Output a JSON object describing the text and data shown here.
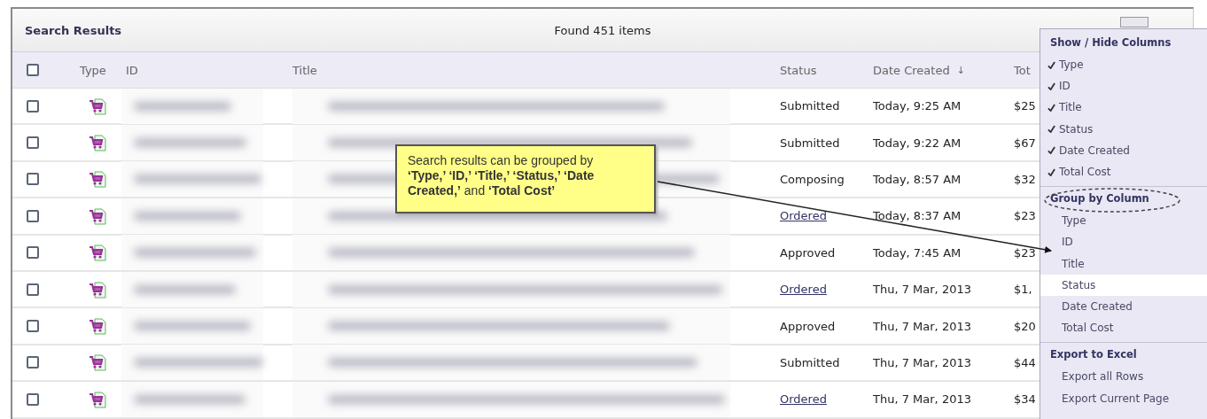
{
  "panel": {
    "title": "Search Results",
    "count": "Found 451 items"
  },
  "table": {
    "select_all": {
      "checked": false
    },
    "columns": [
      {
        "label": "Type"
      },
      {
        "label": "ID"
      },
      {
        "label": "Title"
      },
      {
        "label": "Status"
      },
      {
        "label": "Date Created",
        "sort_indicator": "↓"
      },
      {
        "label": "Tot"
      }
    ],
    "rows": [
      {
        "checked": false,
        "status": "Submitted",
        "linked": false,
        "date_created": "Today, 9:25 AM",
        "total_cost": "$25"
      },
      {
        "checked": false,
        "status": "Submitted",
        "linked": false,
        "date_created": "Today, 9:22 AM",
        "total_cost": "$67"
      },
      {
        "checked": false,
        "status": "Composing",
        "linked": false,
        "date_created": "Today, 8:57 AM",
        "total_cost": "$32"
      },
      {
        "checked": false,
        "status": "Ordered",
        "linked": true,
        "date_created": "Today, 8:37 AM",
        "total_cost": "$23"
      },
      {
        "checked": false,
        "status": "Approved",
        "linked": false,
        "date_created": "Today, 7:45 AM",
        "total_cost": "$23"
      },
      {
        "checked": false,
        "status": "Ordered",
        "linked": true,
        "date_created": "Thu, 7 Mar, 2013",
        "total_cost": "$1,"
      },
      {
        "checked": false,
        "status": "Approved",
        "linked": false,
        "date_created": "Thu, 7 Mar, 2013",
        "total_cost": "$20"
      },
      {
        "checked": false,
        "status": "Submitted",
        "linked": false,
        "date_created": "Thu, 7 Mar, 2013",
        "total_cost": "$44"
      },
      {
        "checked": false,
        "status": "Ordered",
        "linked": true,
        "date_created": "Thu, 7 Mar, 2013",
        "total_cost": "$34"
      }
    ]
  },
  "column_menu": {
    "sections": [
      {
        "heading": "Show / Hide Columns",
        "circled": false,
        "items": [
          {
            "label": "Type",
            "checked": true
          },
          {
            "label": "ID",
            "checked": true
          },
          {
            "label": "Title",
            "checked": true
          },
          {
            "label": "Status",
            "checked": true
          },
          {
            "label": "Date Created",
            "checked": true
          },
          {
            "label": "Total Cost",
            "checked": true
          }
        ]
      },
      {
        "heading": "Group by Column",
        "circled": true,
        "items": [
          {
            "label": "Type",
            "highlighted": false
          },
          {
            "label": "ID",
            "highlighted": false
          },
          {
            "label": "Title",
            "highlighted": false
          },
          {
            "label": "Status",
            "highlighted": true
          },
          {
            "label": "Date Created",
            "highlighted": false
          },
          {
            "label": "Total Cost",
            "highlighted": false
          }
        ]
      },
      {
        "heading": "Export to Excel",
        "circled": false,
        "items": [
          {
            "label": "Export all Rows"
          },
          {
            "label": "Export Current Page"
          }
        ]
      }
    ]
  },
  "callout": {
    "text": "Search results can be grouped by **‘Type,’ ‘ID,’  ‘Title,’ ‘Status,’ ‘Date Created,’** and **‘Total Cost’**"
  }
}
